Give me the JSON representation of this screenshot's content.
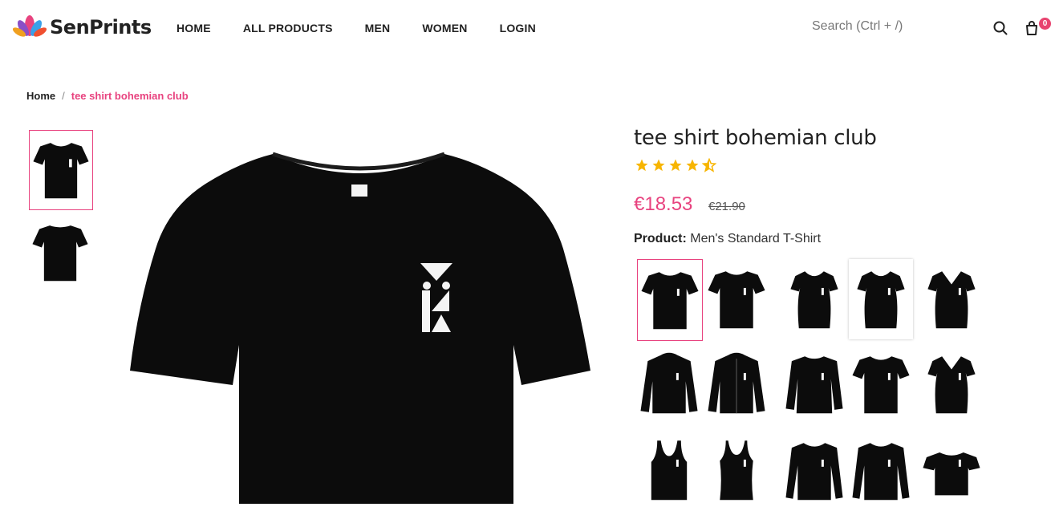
{
  "brand": {
    "name": "SenPrints"
  },
  "nav": {
    "items": [
      {
        "label": "HOME"
      },
      {
        "label": "ALL PRODUCTS"
      },
      {
        "label": "MEN"
      },
      {
        "label": "WOMEN"
      },
      {
        "label": "LOGIN"
      }
    ]
  },
  "search": {
    "placeholder": "Search (Ctrl + /)"
  },
  "cart": {
    "count": "0"
  },
  "breadcrumb": {
    "home": "Home",
    "separator": "/",
    "current": "tee shirt bohemian club"
  },
  "product": {
    "title": "tee shirt bohemian club",
    "rating": 4.5,
    "price": "€18.53",
    "old_price": "€21.90",
    "product_label": "Product:",
    "product_value": "Men's Standard T-Shirt"
  },
  "gallery": {
    "thumbs": [
      {
        "view": "front",
        "selected": true
      },
      {
        "view": "back",
        "selected": false
      }
    ]
  },
  "variants": [
    {
      "type": "tshirt",
      "selected": true
    },
    {
      "type": "tshirt"
    },
    {
      "type": "ladies-tee"
    },
    {
      "type": "ladies-tee",
      "boxed": true
    },
    {
      "type": "ladies-vneck"
    },
    {
      "type": "hoodie"
    },
    {
      "type": "zip-hoodie"
    },
    {
      "type": "sweatshirt"
    },
    {
      "type": "tshirt"
    },
    {
      "type": "ladies-vneck"
    },
    {
      "type": "tank-men"
    },
    {
      "type": "tank-women"
    },
    {
      "type": "longsleeve"
    },
    {
      "type": "longsleeve"
    },
    {
      "type": "tshirt-flat"
    }
  ],
  "colors": {
    "accent": "#e8437f",
    "star": "#f7b500",
    "garment": "#0c0c0c"
  }
}
